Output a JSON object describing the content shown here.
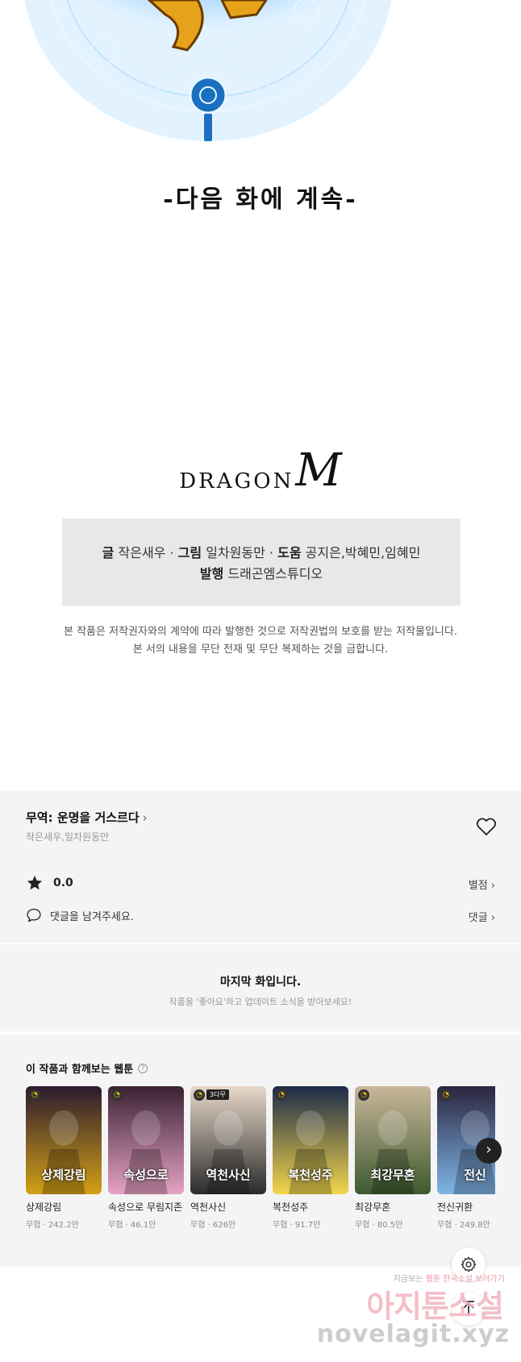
{
  "panel": {
    "continued_text": "-다음 화에 계속-"
  },
  "publisher_logo": {
    "text": "DRAGON",
    "mark": "M"
  },
  "credits": {
    "writer_label": "글",
    "writer": "작은새우",
    "sep1": "·",
    "artist_label": "그림",
    "artist": "일차원동만",
    "sep2": "·",
    "assist_label": "도움",
    "assist": "공지은,박혜민,임혜민",
    "publisher_label": "발행",
    "publisher": "드래곤엠스튜디오"
  },
  "copyright": {
    "line1": "본 작품은 저작권자와의 계약에 따라 발행한 것으로 저작권법의 보호를 받는 저작물입니다.",
    "line2": "본 서의 내용을 무단 전재 및 무단 복제하는 것을 금합니다."
  },
  "info": {
    "title": "무역: 운명을 거스르다",
    "title_chevron": "›",
    "authors": "작은새우,일차원동만",
    "rating": "0.0",
    "rating_link": "별점 ›",
    "comment_prompt": "댓글을 남겨주세요.",
    "comments_link": "댓글 ›",
    "icons": [
      "heart-icon",
      "star-icon",
      "comment-icon"
    ]
  },
  "last_episode": {
    "title": "마지막 화입니다.",
    "subtitle": "작품을 '좋아요'하고 업데이트 소식을 받아보세요!"
  },
  "recommendations": {
    "title": "이 작품과 함께보는 웹툰",
    "help": "?",
    "next": "›",
    "items": [
      {
        "name": "상제강림",
        "genre": "무협",
        "views": "242.2만",
        "badge": "",
        "art_text": "상제강림",
        "c1": "#2a1a2e",
        "c2": "#d4a017"
      },
      {
        "name": "속성으로 무림지존",
        "genre": "무협",
        "views": "46.1만",
        "badge": "",
        "art_text": "속성으로",
        "c1": "#3a2233",
        "c2": "#e7a3c4"
      },
      {
        "name": "역천사신",
        "genre": "무협",
        "views": "626만",
        "badge": "3다무",
        "art_text": "역천사신",
        "c1": "#e7d8c9",
        "c2": "#2b2b2b"
      },
      {
        "name": "복천성주",
        "genre": "무협",
        "views": "91.7만",
        "badge": "",
        "art_text": "복천성주",
        "c1": "#1c2a4a",
        "c2": "#f2d64b"
      },
      {
        "name": "최강무혼",
        "genre": "무협",
        "views": "80.5만",
        "badge": "",
        "art_text": "최강무혼",
        "c1": "#c9b79a",
        "c2": "#3d5a2e"
      },
      {
        "name": "전신귀환",
        "genre": "무협",
        "views": "249.8만",
        "badge": "",
        "art_text": "전신",
        "c1": "#2b2540",
        "c2": "#7fb6e8"
      }
    ]
  },
  "floating": {
    "settings_icon": "gear-icon",
    "top_icon": "arrow-up-icon"
  },
  "watermark": {
    "line1_a": "지금보는",
    "line1_b": "웹툰",
    "line1_c": "한국소설",
    "line1_d": "보러가기",
    "line2": "아지툰소설",
    "line3": "novelagit.xyz"
  },
  "colors": {
    "section_bg": "#f4f4f4",
    "credits_bg": "#e8e8e8",
    "magic_blue": "#2a8fe0",
    "magic_gold": "#e6a21a"
  }
}
